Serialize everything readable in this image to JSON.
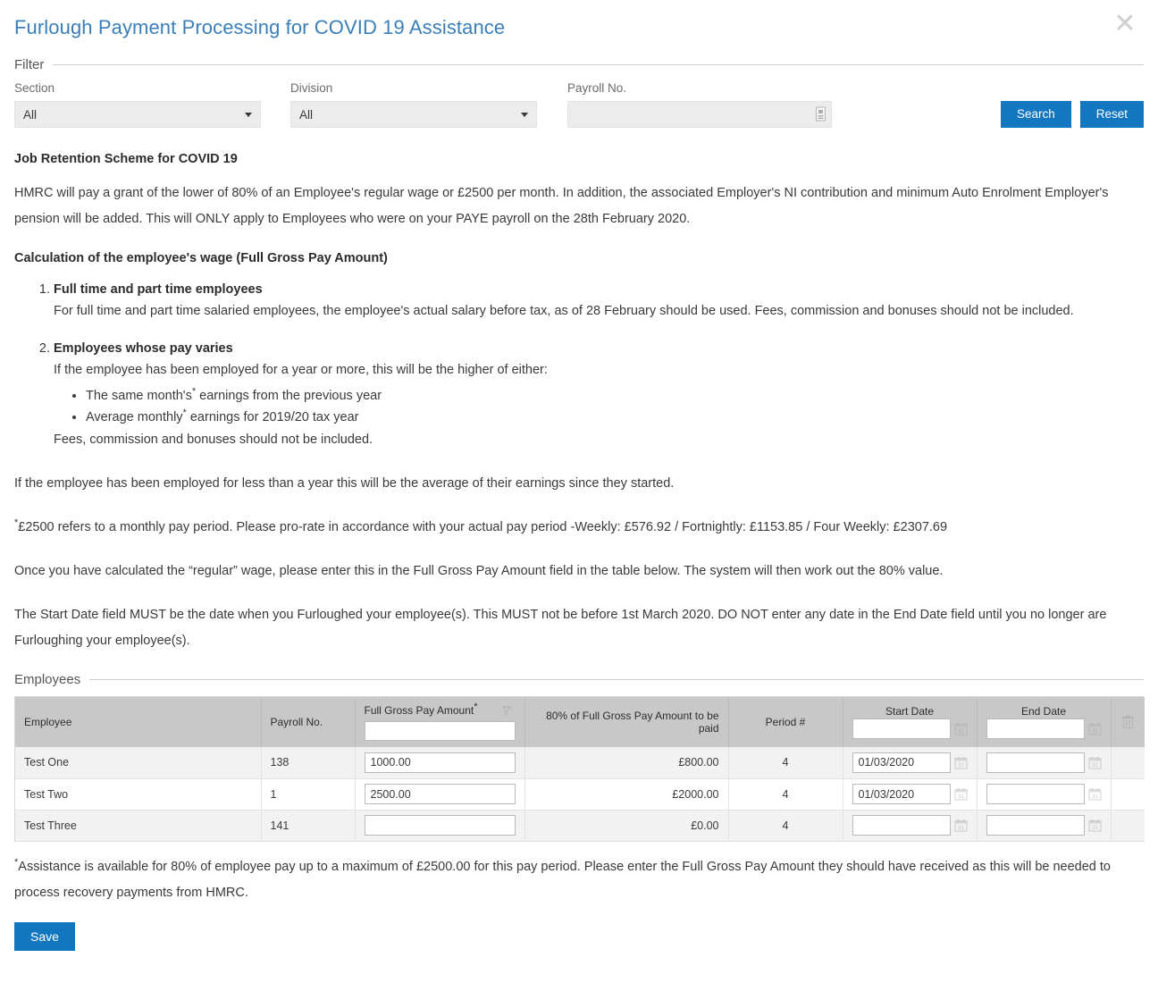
{
  "header": {
    "title": "Furlough Payment Processing for COVID 19 Assistance",
    "close_icon": "close-icon"
  },
  "filter": {
    "legend": "Filter",
    "section": {
      "label": "Section",
      "value": "All"
    },
    "division": {
      "label": "Division",
      "value": "All"
    },
    "payroll_no": {
      "label": "Payroll No.",
      "value": "",
      "placeholder": ""
    },
    "search_label": "Search",
    "reset_label": "Reset",
    "accent_color": "#1377c0"
  },
  "content": {
    "scheme_heading": "Job Retention Scheme for COVID 19",
    "intro_paragraph": "HMRC will pay a grant of the lower of 80% of an Employee's regular wage or £2500 per month. In addition, the associated Employer's NI contribution and minimum Auto Enrolment Employer's pension will be added. This will ONLY apply to Employees who were on your PAYE payroll on the 28th February 2020.",
    "calculation_heading": "Calculation of the employee's wage (Full Gross Pay Amount)",
    "steps": [
      {
        "title": "Full time and part time employees",
        "text": "For full time and part time salaried employees, the employee's actual salary before tax, as of 28 February should be used. Fees, commission and bonuses should not be included."
      },
      {
        "title": "Employees whose pay varies",
        "text": "If the employee has been employed for a year or more, this will be the higher of either:",
        "bullet_a_pre": "The same month's",
        "bullet_a_post": " earnings from the previous year",
        "bullet_b_pre": "Average monthly",
        "bullet_b_post": " earnings for 2019/20 tax year",
        "after_bullets": "Fees, commission and bonuses should not be included."
      }
    ],
    "less_than_year": "If the employee has been employed for less than a year this will be the average of their earnings since they started.",
    "prorate_note": "£2500 refers to a monthly pay period. Please pro-rate in accordance with your actual pay period -Weekly: £576.92 / Fortnightly: £1153.85 / Four Weekly: £2307.69",
    "regular_wage_note": "Once you have calculated the “regular” wage, please enter this in the Full Gross Pay Amount field in the table below. The system will then work out the 80% value.",
    "start_date_note": "The Start Date field MUST be the date when you Furloughed your employee(s). This MUST not be before 1st March 2020. DO NOT enter any date in the End Date field until you no longer are Furloughing your employee(s)."
  },
  "employees": {
    "legend": "Employees",
    "columns": {
      "employee": "Employee",
      "payroll_no": "Payroll No.",
      "full_gross_pay": "Full Gross Pay Amount",
      "eighty_percent": "80% of Full Gross Pay Amount to be paid",
      "period": "Period #",
      "start_date": "Start Date",
      "end_date": "End Date",
      "delete": "delete-column"
    },
    "header_inputs": {
      "full_gross_pay_value": "",
      "start_date_value": "",
      "end_date_value": ""
    },
    "header_icons": {
      "fill_down": "fill-down-icon",
      "start_date_calendar": "calendar-icon",
      "end_date_calendar": "calendar-icon",
      "delete_all": "trash-icon"
    },
    "rows": [
      {
        "employee": "Test One",
        "payroll_no": "138",
        "full_gross_pay": "1000.00",
        "eighty_percent": "£800.00",
        "period": "4",
        "start_date": "01/03/2020",
        "end_date": ""
      },
      {
        "employee": "Test Two",
        "payroll_no": "1",
        "full_gross_pay": "2500.00",
        "eighty_percent": "£2000.00",
        "period": "4",
        "start_date": "01/03/2020",
        "end_date": ""
      },
      {
        "employee": "Test Three",
        "payroll_no": "141",
        "full_gross_pay": "",
        "eighty_percent": "£0.00",
        "period": "4",
        "start_date": "",
        "end_date": ""
      }
    ],
    "table_note": "Assistance is available for 80% of employee pay up to a maximum of £2500.00 for this pay period. Please enter the Full Gross Pay Amount they should have received as this will be needed to process recovery payments from HMRC.",
    "save_label": "Save"
  }
}
